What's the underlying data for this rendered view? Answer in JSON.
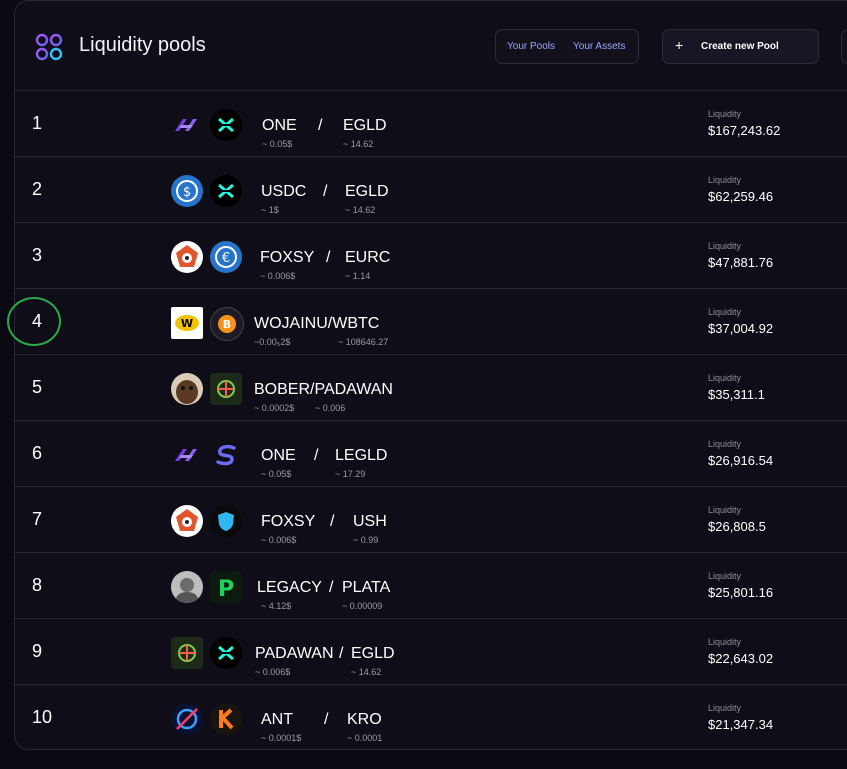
{
  "header": {
    "title": "Liquidity pools",
    "tab_pools": "Your Pools",
    "tab_assets": "Your Assets",
    "create_plus": "+",
    "create_label": "Create new Pool"
  },
  "pools": [
    {
      "rank": "1",
      "t1": "ONE",
      "sep": "/",
      "t2": "EGLD",
      "p1": "~ 0.05$",
      "p2": "~ 14.62",
      "liq_label": "Liquidity",
      "liq": "$167,243.62"
    },
    {
      "rank": "2",
      "t1": "USDC",
      "sep": "/",
      "t2": "EGLD",
      "p1": "~ 1$",
      "p2": "~ 14.62",
      "liq_label": "Liquidity",
      "liq": "$62,259.46"
    },
    {
      "rank": "3",
      "t1": "FOXSY",
      "sep": "/",
      "t2": "EURC",
      "p1": "~ 0.006$",
      "p2": "~ 1.14",
      "liq_label": "Liquidity",
      "liq": "$47,881.76"
    },
    {
      "rank": "4",
      "t1": "WOJAINU/WBTC",
      "sep": "",
      "t2": "",
      "p1": "~0.00₅2$",
      "p2": "~ 108646.27",
      "liq_label": "Liquidity",
      "liq": "$37,004.92"
    },
    {
      "rank": "5",
      "t1": "BOBER/PADAWAN",
      "sep": "",
      "t2": "",
      "p1": "~ 0.0002$",
      "p2": "~ 0.006",
      "liq_label": "Liquidity",
      "liq": "$35,311.1"
    },
    {
      "rank": "6",
      "t1": "ONE",
      "sep": "/",
      "t2": "LEGLD",
      "p1": "~ 0.05$",
      "p2": "~ 17.29",
      "liq_label": "Liquidity",
      "liq": "$26,916.54"
    },
    {
      "rank": "7",
      "t1": "FOXSY",
      "sep": "/",
      "t2": "USH",
      "p1": "~ 0.006$",
      "p2": "~ 0.99",
      "liq_label": "Liquidity",
      "liq": "$26,808.5"
    },
    {
      "rank": "8",
      "t1": "LEGACY",
      "sep": "/",
      "t2": "PLATA",
      "p1": "~ 4.12$",
      "p2": "~ 0.00009",
      "liq_label": "Liquidity",
      "liq": "$25,801.16"
    },
    {
      "rank": "9",
      "t1": "PADAWAN",
      "sep": "/",
      "t2": "EGLD",
      "p1": "~ 0.006$",
      "p2": "~ 14.62",
      "liq_label": "Liquidity",
      "liq": "$22,643.02"
    },
    {
      "rank": "10",
      "t1": "ANT",
      "sep": "/",
      "t2": "KRO",
      "p1": "~ 0.0001$",
      "p2": "~ 0.0001",
      "liq_label": "Liquidity",
      "liq": "$21,347.34"
    }
  ],
  "icons": {
    "row1": [
      "one-token-icon",
      "egld-token-icon"
    ],
    "row2": [
      "usdc-token-icon",
      "egld-token-icon"
    ],
    "row3": [
      "foxsy-token-icon",
      "eurc-token-icon"
    ],
    "row4": [
      "wojainu-token-icon",
      "wbtc-token-icon"
    ],
    "row5": [
      "bober-token-icon",
      "padawan-token-icon"
    ],
    "row6": [
      "one-token-icon",
      "legld-token-icon"
    ],
    "row7": [
      "foxsy-token-icon",
      "ush-token-icon"
    ],
    "row8": [
      "legacy-token-icon",
      "plata-token-icon"
    ],
    "row9": [
      "padawan-token-icon",
      "egld-token-icon"
    ],
    "row10": [
      "ant-token-icon",
      "kro-token-icon"
    ]
  },
  "colors": {
    "background": "#0b0a12",
    "panel": "#0f0e18",
    "accent": "#9aa6ff",
    "annotation": "#2aa84a"
  }
}
